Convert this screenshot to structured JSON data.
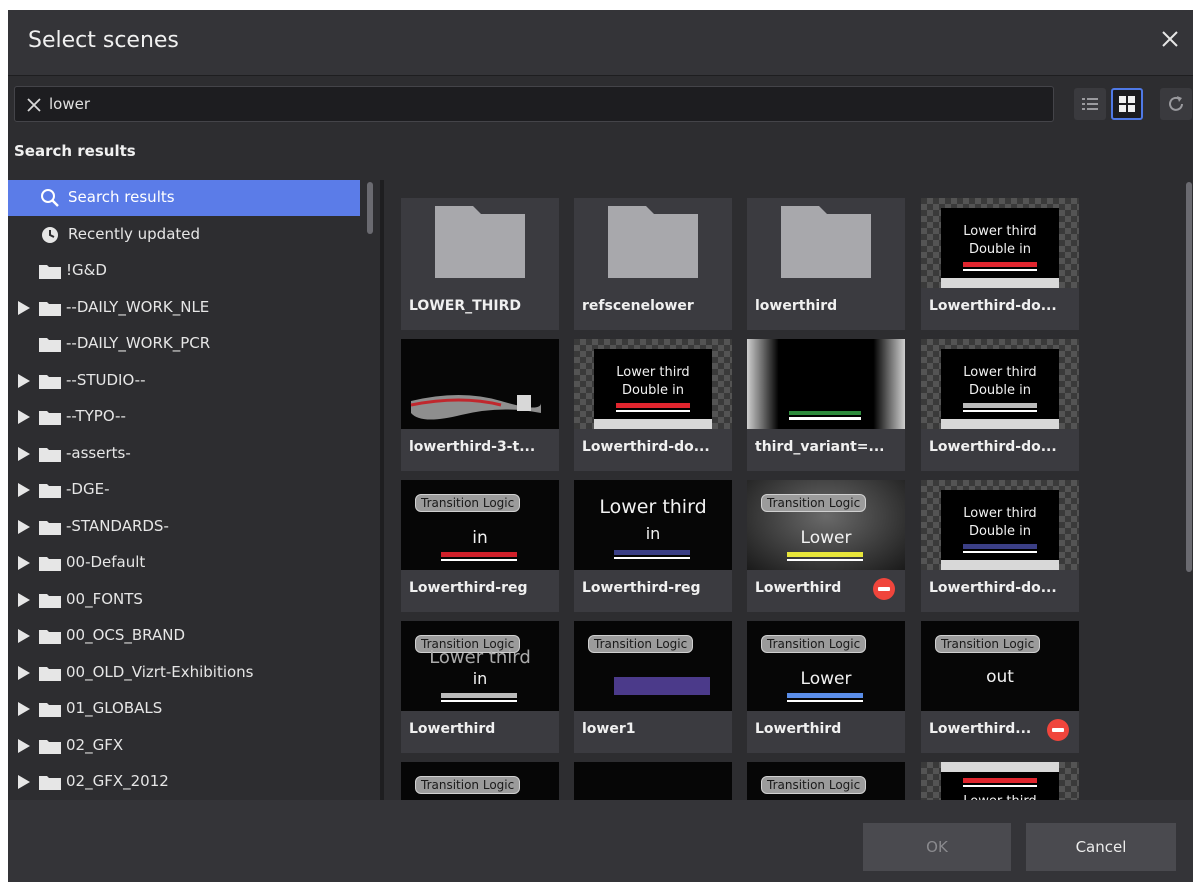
{
  "dialog": {
    "title": "Select scenes"
  },
  "search": {
    "value": "lower",
    "placeholder": ""
  },
  "section_label": "Search results",
  "sidebar": {
    "items": [
      {
        "label": "Search results",
        "icon": "search-icon",
        "expandable": false,
        "selected": true
      },
      {
        "label": "Recently updated",
        "icon": "clock-icon",
        "expandable": false,
        "selected": false
      },
      {
        "label": "!G&D",
        "icon": "folder-icon",
        "expandable": false,
        "selected": false
      },
      {
        "label": "--DAILY_WORK_NLE",
        "icon": "folder-icon",
        "expandable": true,
        "selected": false
      },
      {
        "label": "--DAILY_WORK_PCR",
        "icon": "folder-icon",
        "expandable": false,
        "selected": false
      },
      {
        "label": "--STUDIO--",
        "icon": "folder-icon",
        "expandable": true,
        "selected": false
      },
      {
        "label": "--TYPO--",
        "icon": "folder-icon",
        "expandable": true,
        "selected": false
      },
      {
        "label": "-asserts-",
        "icon": "folder-icon",
        "expandable": true,
        "selected": false
      },
      {
        "label": "-DGE-",
        "icon": "folder-icon",
        "expandable": true,
        "selected": false
      },
      {
        "label": "-STANDARDS-",
        "icon": "folder-icon",
        "expandable": true,
        "selected": false
      },
      {
        "label": "00-Default",
        "icon": "folder-icon",
        "expandable": true,
        "selected": false
      },
      {
        "label": "00_FONTS",
        "icon": "folder-icon",
        "expandable": true,
        "selected": false
      },
      {
        "label": "00_OCS_BRAND",
        "icon": "folder-icon",
        "expandable": true,
        "selected": false
      },
      {
        "label": "00_OLD_Vizrt-Exhibitions",
        "icon": "folder-icon",
        "expandable": true,
        "selected": false
      },
      {
        "label": "01_GLOBALS",
        "icon": "folder-icon",
        "expandable": true,
        "selected": false
      },
      {
        "label": "02_GFX",
        "icon": "folder-icon",
        "expandable": true,
        "selected": false
      },
      {
        "label": "02_GFX_2012",
        "icon": "folder-icon",
        "expandable": true,
        "selected": false
      }
    ]
  },
  "tiles": [
    {
      "label": "LOWER_THIRD",
      "kind": "folder"
    },
    {
      "label": "refscenelower",
      "kind": "folder"
    },
    {
      "label": "lowerthird",
      "kind": "folder"
    },
    {
      "label": "Lowerthird-do...",
      "kind": "checker",
      "line1": "Lower third",
      "line2": "Double in",
      "bar": "#e0252e"
    },
    {
      "label": "lowerthird-3-t...",
      "kind": "flag"
    },
    {
      "label": "Lowerthird-do...",
      "kind": "checker",
      "line1": "Lower third",
      "line2": "Double in",
      "bar": "#e0252e"
    },
    {
      "label": "third_variant=...",
      "kind": "variant",
      "bar": "#2e8b3c"
    },
    {
      "label": "Lowerthird-do...",
      "kind": "checker",
      "line1": "Lower third",
      "line2": "Double in",
      "bar": "#bbbbbb"
    },
    {
      "label": "Lowerthird-reg",
      "kind": "transition",
      "pill": "Transition Logic",
      "text": "in",
      "bar": "#d0202a"
    },
    {
      "label": "Lowerthird-reg",
      "kind": "plain",
      "line1": "Lower third",
      "line2": "in",
      "bar": "#3b3f86"
    },
    {
      "label": "Lowerthird",
      "kind": "transition-gray",
      "pill": "Transition Logic",
      "text": "Lower",
      "bar": "#e8e63a",
      "blocked": true
    },
    {
      "label": "Lowerthird-do...",
      "kind": "checker",
      "line1": "Lower third",
      "line2": "Double in",
      "bar": "#3b3f86"
    },
    {
      "label": "Lowerthird",
      "kind": "transition-ghost",
      "pill": "Transition Logic",
      "ghost": "Lower third",
      "text": "in",
      "bar": "#bbbbbb"
    },
    {
      "label": "lower1",
      "kind": "transition-rect",
      "pill": "Transition Logic",
      "rect": "#4b3a8a"
    },
    {
      "label": "Lowerthird",
      "kind": "transition",
      "pill": "Transition Logic",
      "text": "Lower",
      "bar": "#5a8de8"
    },
    {
      "label": "Lowerthird...",
      "kind": "transition",
      "pill": "Transition Logic",
      "text": "out",
      "bar": "",
      "blocked": true
    },
    {
      "label": "",
      "kind": "transition-partial",
      "pill": "Transition Logic"
    },
    {
      "label": "",
      "kind": "black-partial"
    },
    {
      "label": "",
      "kind": "transition-partial",
      "pill": "Transition Logic"
    },
    {
      "label": "",
      "kind": "checker-partial",
      "line1": "Lower third",
      "bar": "#e0252e"
    }
  ],
  "footer": {
    "ok_label": "OK",
    "cancel_label": "Cancel"
  },
  "colors": {
    "selection": "#5b7ce8",
    "blocked": "#f0453c",
    "background": "#2d2d30"
  }
}
